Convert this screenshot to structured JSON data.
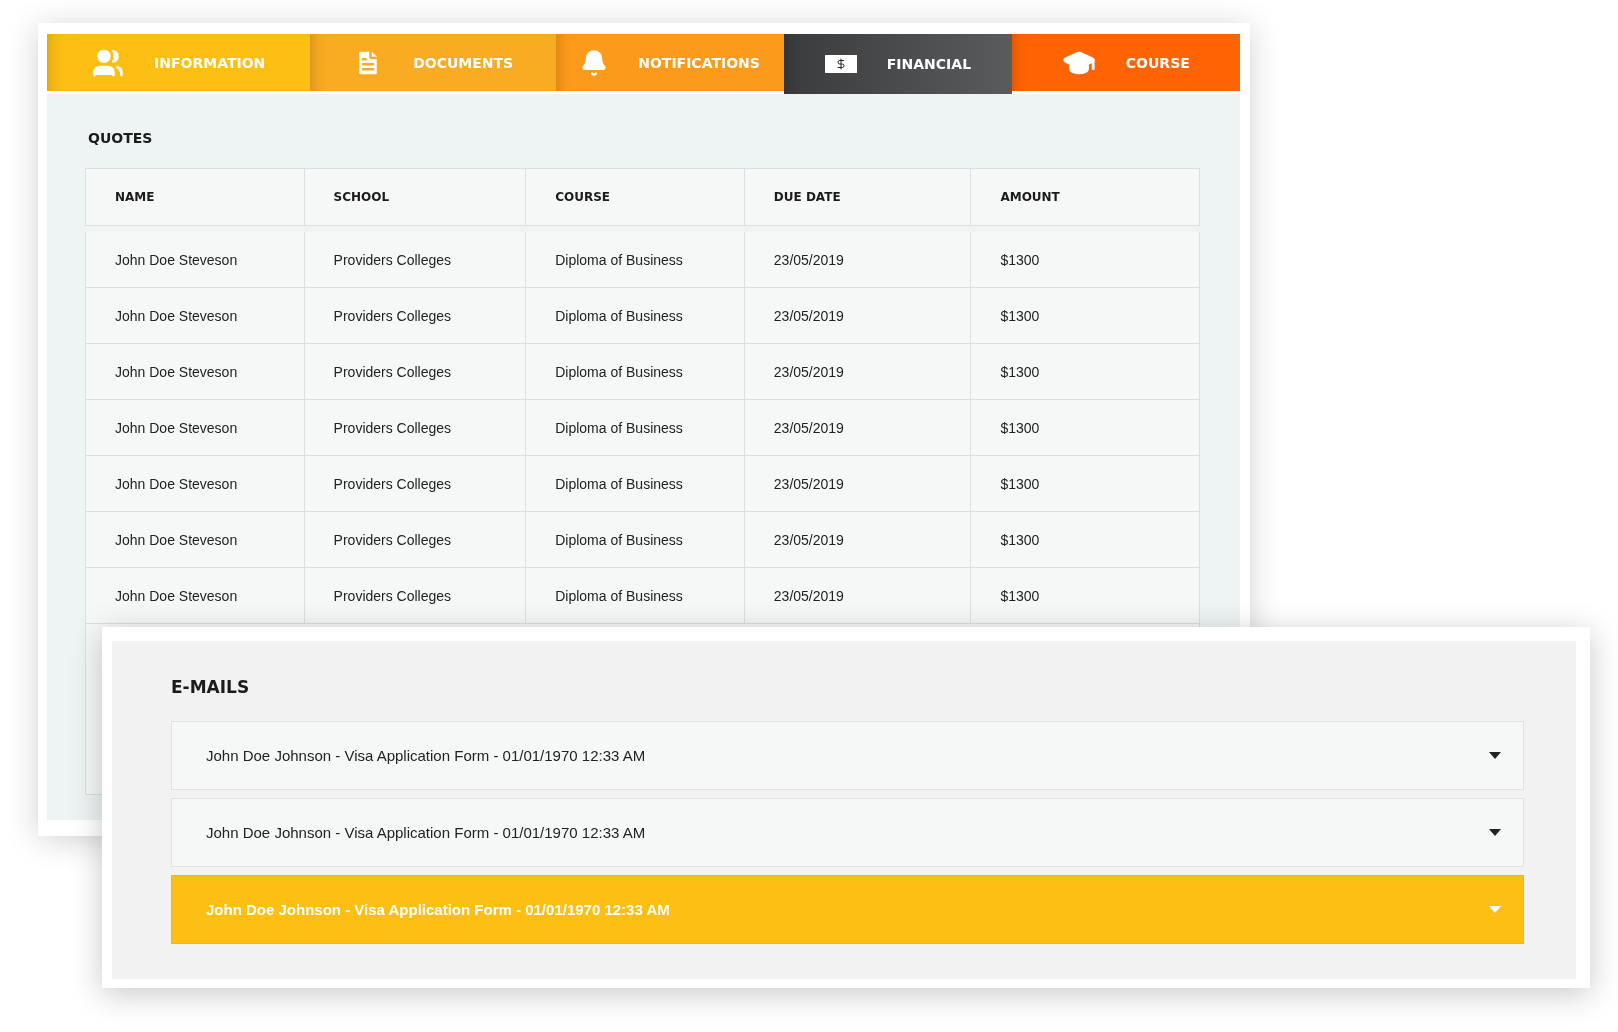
{
  "tabs": [
    {
      "label": "INFORMATION",
      "color": "#fdbf14",
      "selected": false
    },
    {
      "label": "DOCUMENTS",
      "color": "#f9ab22",
      "selected": false
    },
    {
      "label": "NOTIFICATIONS",
      "color": "#fc9a1b",
      "selected": false
    },
    {
      "label": "FINANCIAL",
      "color": "#3a3b3d",
      "selected": true
    },
    {
      "label": "COURSE",
      "color": "#ff6404",
      "selected": false
    }
  ],
  "quotes": {
    "title": "QUOTES",
    "columns": [
      "NAME",
      "SCHOOL",
      "COURSE",
      "DUE DATE",
      "AMOUNT"
    ],
    "rows": [
      [
        "John Doe Steveson",
        "Providers Colleges",
        "Diploma of Business",
        "23/05/2019",
        "$1300"
      ],
      [
        "John Doe Steveson",
        "Providers Colleges",
        "Diploma of Business",
        "23/05/2019",
        "$1300"
      ],
      [
        "John Doe Steveson",
        "Providers Colleges",
        "Diploma of Business",
        "23/05/2019",
        "$1300"
      ],
      [
        "John Doe Steveson",
        "Providers Colleges",
        "Diploma of Business",
        "23/05/2019",
        "$1300"
      ],
      [
        "John Doe Steveson",
        "Providers Colleges",
        "Diploma of Business",
        "23/05/2019",
        "$1300"
      ],
      [
        "John Doe Steveson",
        "Providers Colleges",
        "Diploma of Business",
        "23/05/2019",
        "$1300"
      ],
      [
        "John Doe Steveson",
        "Providers Colleges",
        "Diploma of Business",
        "23/05/2019",
        "$1300"
      ]
    ]
  },
  "emails": {
    "title": "E-MAILS",
    "items": [
      {
        "text": "John Doe Johnson - Visa Application Form - 01/01/1970 12:33 AM",
        "selected": false
      },
      {
        "text": "John Doe Johnson - Visa Application Form - 01/01/1970 12:33 AM",
        "selected": false
      },
      {
        "text": "John Doe Johnson - Visa Application Form - 01/01/1970 12:33 AM",
        "selected": true
      }
    ]
  }
}
